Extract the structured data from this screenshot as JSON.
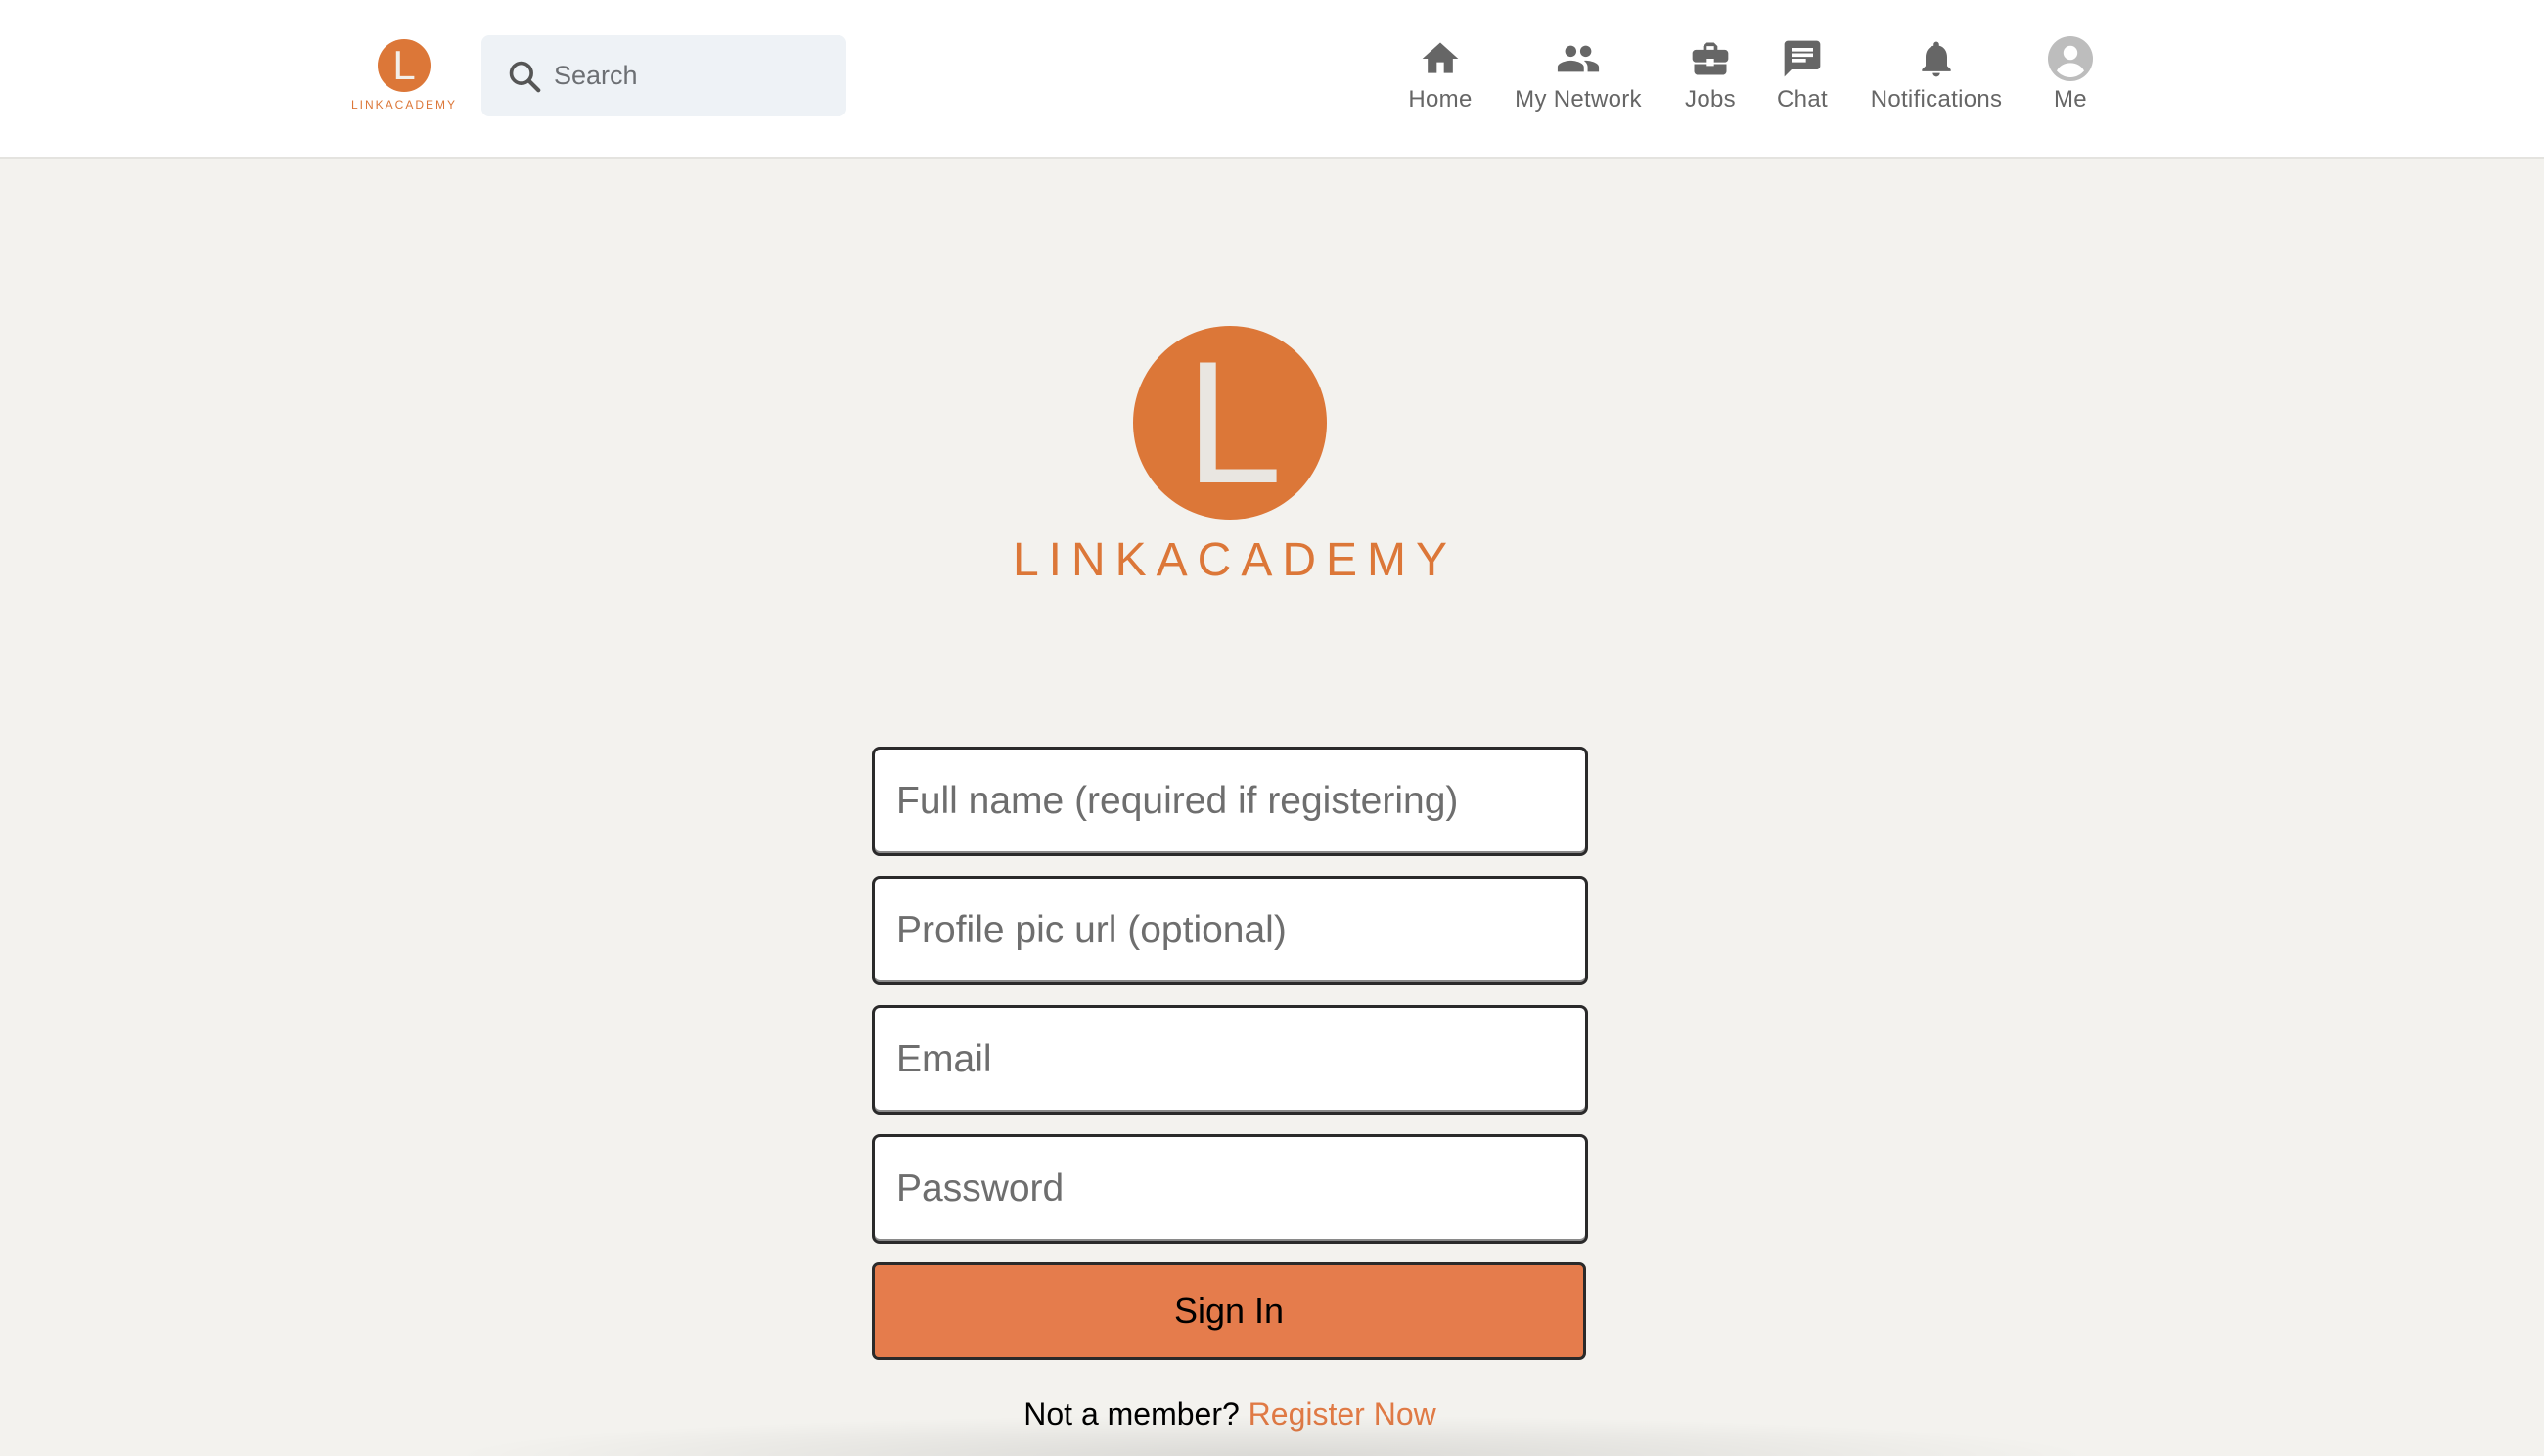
{
  "brand": {
    "initial": "L",
    "name": "LINKACADEMY"
  },
  "search": {
    "placeholder": "Search",
    "icon": "search-icon"
  },
  "nav": [
    {
      "label": "Home",
      "icon": "home-icon"
    },
    {
      "label": "My Network",
      "icon": "people-icon"
    },
    {
      "label": "Jobs",
      "icon": "briefcase-icon"
    },
    {
      "label": "Chat",
      "icon": "chat-icon"
    },
    {
      "label": "Notifications",
      "icon": "bell-icon"
    },
    {
      "label": "Me",
      "icon": "avatar-icon"
    }
  ],
  "login": {
    "logo_initial": "L",
    "logo_name": "LINKACADEMY",
    "fullname_placeholder": "Full name (required if registering)",
    "profile_pic_placeholder": "Profile pic url (optional)",
    "email_placeholder": "Email",
    "password_placeholder": "Password",
    "signin_label": "Sign In",
    "not_member_text": "Not a member?",
    "register_label": "Register Now"
  },
  "colors": {
    "brand_orange": "#dc7738",
    "button_orange": "#e57c4c",
    "background": "#f3f2ee",
    "nav_gray": "#666666"
  }
}
